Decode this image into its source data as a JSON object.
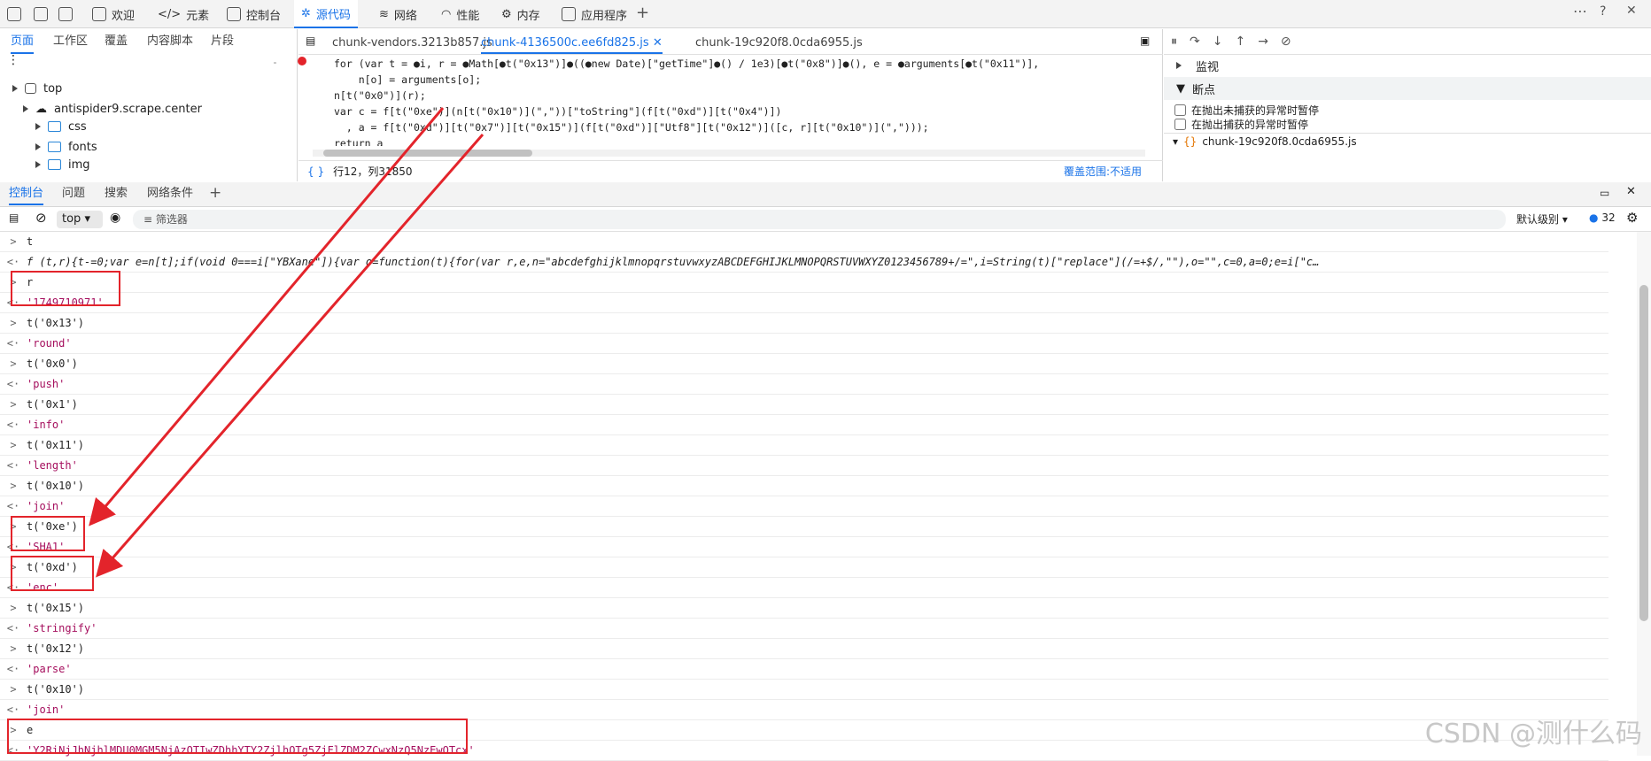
{
  "top_tabs": [
    "欢迎",
    "元素",
    "控制台",
    "源代码",
    "网络",
    "性能",
    "内存",
    "应用程序"
  ],
  "nav": {
    "tabs": [
      "页面",
      "工作区",
      "覆盖",
      "内容脚本",
      "片段"
    ],
    "tree": [
      "top",
      "antispider9.scrape.center",
      "css",
      "fonts",
      "img"
    ]
  },
  "editor": {
    "tabs": [
      "chunk-vendors.3213b857.js",
      "chunk-4136500c.ee6fd825.js",
      "chunk-19c920f8.0cda6955.js"
    ],
    "lines": [
      "for (var t = ●i, r = ●Math[●t(\"0x13\")]●((●new Date)[\"getTime\"]●() / 1e3)[●t(\"0x8\")]●(), e = ●arguments[●t(\"0x11\")],",
      "    n[o] = arguments[o];",
      "n[t(\"0x0\")](r);",
      "var c = f[t(\"0xe\")](n[t(\"0x10\")](\",\"))[\"toString\"](f[t(\"0xd\")][t(\"0x4\")])",
      "  , a = f[t(\"0xd\")][t(\"0x7\")][t(\"0x15\")](f[t(\"0xd\")][\"Utf8\"][t(\"0x12\")]([c, r][t(\"0x10\")](\",\")));",
      "return a"
    ],
    "status": "行12，列31850",
    "coverage_label": "覆盖范围:",
    "coverage_value": "不适用"
  },
  "debugger": {
    "watch": "监视",
    "breakpoints": "断点",
    "opts": [
      "在抛出未捕获的异常时暂停",
      "在抛出捕获的异常时暂停"
    ],
    "file": "chunk-19c920f8.0cda6955.js"
  },
  "drawer_tabs": [
    "控制台",
    "问题",
    "搜索",
    "网络条件"
  ],
  "console": {
    "context": "top",
    "filter": "筛选器",
    "level": "默认级别",
    "issues": "32",
    "lines": [
      {
        "t": "in",
        "v": "t"
      },
      {
        "t": "fn",
        "v": "f (t,r){t-=0;var e=n[t];if(void 0===i[\"YBXane\"]){var o=function(t){for(var r,e,n=\"abcdefghijklmnopqrstuvwxyzABCDEFGHIJKLMNOPQRSTUVWXYZ0123456789+/=\",i=String(t)[\"replace\"](/=+$/,\"\"),o=\"\",c=0,a=0;e=i[\"c…"
      },
      {
        "t": "in",
        "v": "r"
      },
      {
        "t": "out",
        "v": "'1749710971'"
      },
      {
        "t": "in",
        "v": "t('0x13')"
      },
      {
        "t": "out",
        "v": "'round'"
      },
      {
        "t": "in",
        "v": "t('0x0')"
      },
      {
        "t": "out",
        "v": "'push'"
      },
      {
        "t": "in",
        "v": "t('0x1')"
      },
      {
        "t": "out",
        "v": "'info'"
      },
      {
        "t": "in",
        "v": "t('0x11')"
      },
      {
        "t": "out",
        "v": "'length'"
      },
      {
        "t": "in",
        "v": "t('0x10')"
      },
      {
        "t": "out",
        "v": "'join'"
      },
      {
        "t": "in",
        "v": "t('0xe')"
      },
      {
        "t": "out",
        "v": "'SHA1'"
      },
      {
        "t": "in",
        "v": "t('0xd')"
      },
      {
        "t": "out",
        "v": "'enc'"
      },
      {
        "t": "in",
        "v": "t('0x15')"
      },
      {
        "t": "out",
        "v": "'stringify'"
      },
      {
        "t": "in",
        "v": "t('0x12')"
      },
      {
        "t": "out",
        "v": "'parse'"
      },
      {
        "t": "in",
        "v": "t('0x10')"
      },
      {
        "t": "out",
        "v": "'join'"
      },
      {
        "t": "in",
        "v": "e"
      },
      {
        "t": "out",
        "v": "'Y2RiNjJhNjhlMDU0MGM5NjAzOTIwZDhhYTY2ZjlhOTg5ZjFlZDM2ZCwxNzQ5NzEwOTcx'"
      }
    ]
  },
  "watermark": "CSDN @测什么码"
}
